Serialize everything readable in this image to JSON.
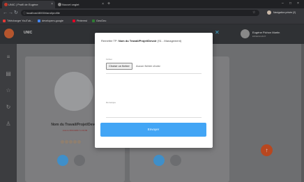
{
  "browser": {
    "tabs": [
      {
        "title": "UNIC | Profil de Eugène",
        "active": true,
        "fav_color": "#c0392b"
      },
      {
        "title": "Nouvel onglet",
        "active": false,
        "fav_color": "#888888"
      }
    ],
    "new_tab_glyph": "+",
    "url": "localhost:8000/rland/profile",
    "profile_label": "Navigation privée (2)",
    "bookmarks": [
      {
        "label": "Télécharger YouTub...",
        "icon_color": "#e53935"
      },
      {
        "label": "developers.google",
        "icon_color": "#4285f4"
      },
      {
        "label": "Pinterest",
        "icon_color": "#e60023"
      },
      {
        "label": "GeoGeo",
        "icon_color": "#2e7d32"
      }
    ]
  },
  "app": {
    "title": "UNIC",
    "user": {
      "name": "Eugène Pichon Martin",
      "role": "ENSEIGNANT"
    },
    "accent_color": "#42a5f5",
    "fab_glyph": "↑"
  },
  "cards": [
    {
      "title": "Nom du Travail/Projet/Devoir",
      "subtitle": "créé le 05/11/2017 à 19:09"
    },
    {
      "title": "",
      "subtitle": ""
    }
  ],
  "modal": {
    "prefix": "Remettre TP:",
    "name": "Nom du Travail/Projet/Devoir",
    "suffix": "(S1 - Management)",
    "file_label": "Fichier",
    "file_button": "Choisir un fichier",
    "file_status": "Aucun fichier choisi",
    "remark_label": "Remarque",
    "remark_value": "",
    "submit_label": "Envoyer"
  }
}
